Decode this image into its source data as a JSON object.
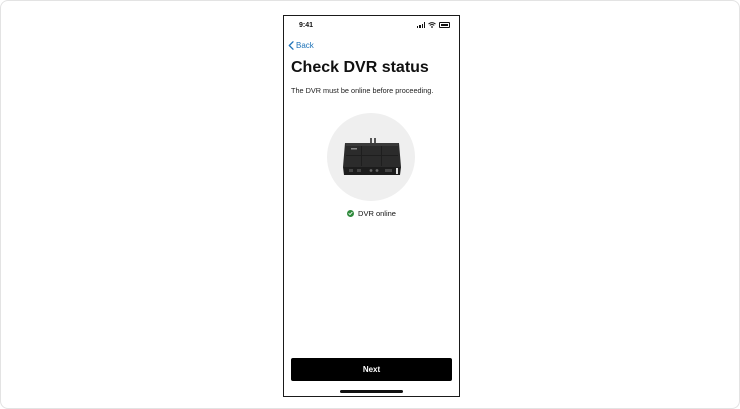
{
  "status_bar": {
    "time": "9:41"
  },
  "nav": {
    "back_label": "Back"
  },
  "page": {
    "title": "Check DVR status",
    "subtitle": "The DVR must be online before proceeding."
  },
  "device_status": {
    "label": "DVR online",
    "color": "#2f8a3c"
  },
  "actions": {
    "next_label": "Next"
  },
  "colors": {
    "link": "#1e73b8",
    "primary_button": "#000000"
  }
}
